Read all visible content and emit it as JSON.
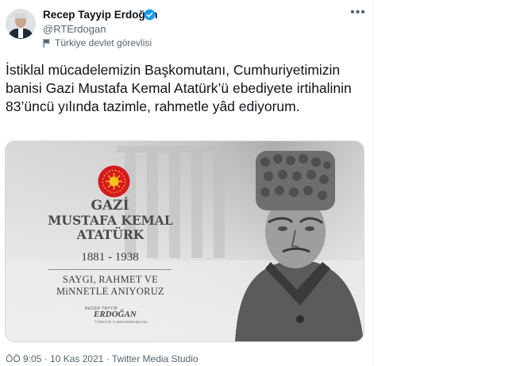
{
  "tweet": {
    "author_name": "Recep Tayyip Erdoğan",
    "handle": "@RTErdogan",
    "account_label": "Türkiye devlet görevlisi",
    "more_icon": "more-dots-icon",
    "text": "İstiklal mücadelemizin Başkomutanı, Cumhuriyetimizin banisi Gazi Mustafa Kemal Atatürk’ü ebediyete irtihalinin 83’üncü yılında tazimle, rahmetle yâd ediyorum.",
    "footer": "ÖÖ 9:05 · 10 Kas 2021 · Twitter Media Studio",
    "verified_color": "#1d9bf0"
  },
  "media": {
    "title_line1": "GAZİ",
    "title_line2": "MUSTAFA KEMAL",
    "title_line3": "ATATÜRK",
    "years": "1881 - 1938",
    "tribute_line1": "SAYGI, RAHMET VE",
    "tribute_line2": "MiNNETLE ANIYORUZ",
    "signature_small": "RECEP TAYYİP",
    "signature": "ERDOĞAN",
    "signature_title": "TÜRKİYE CUMHURBAŞKANI",
    "seal_color": "#d71a21",
    "seal_star_color": "#f4c21b"
  }
}
